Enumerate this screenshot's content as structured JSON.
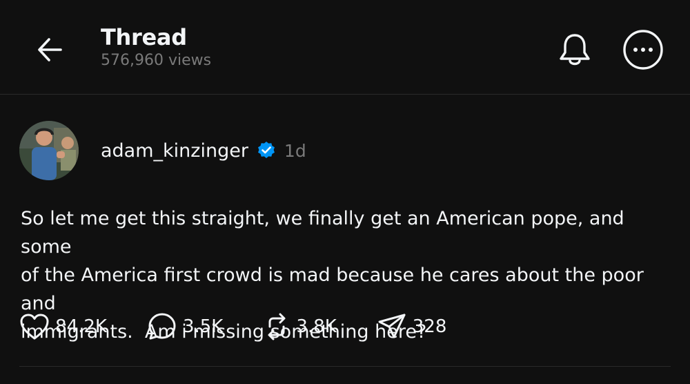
{
  "header": {
    "title": "Thread",
    "views": "576,960 views"
  },
  "post": {
    "username": "adam_kinzinger",
    "verified": true,
    "timestamp": "1d",
    "text": "So let me get this straight, we finally get an American pope, and some\nof the America first crowd is mad because he cares about the poor and\nimmigrants.  Am i missing something here?",
    "actions": {
      "likes": "84.2K",
      "replies": "3.5K",
      "reposts": "3.8K",
      "shares": "328"
    }
  },
  "icons": {
    "back": "arrow-left-icon",
    "notifications": "bell-icon",
    "more": "more-dots-icon",
    "verified": "verified-badge-icon",
    "like": "heart-icon",
    "reply": "comment-icon",
    "repost": "repost-icon",
    "share": "share-icon"
  },
  "colors": {
    "background": "#101010",
    "text": "#f3f5f7",
    "secondary_text": "#7a7a7a",
    "verified": "#0095f6",
    "divider": "#2a2a2a"
  }
}
